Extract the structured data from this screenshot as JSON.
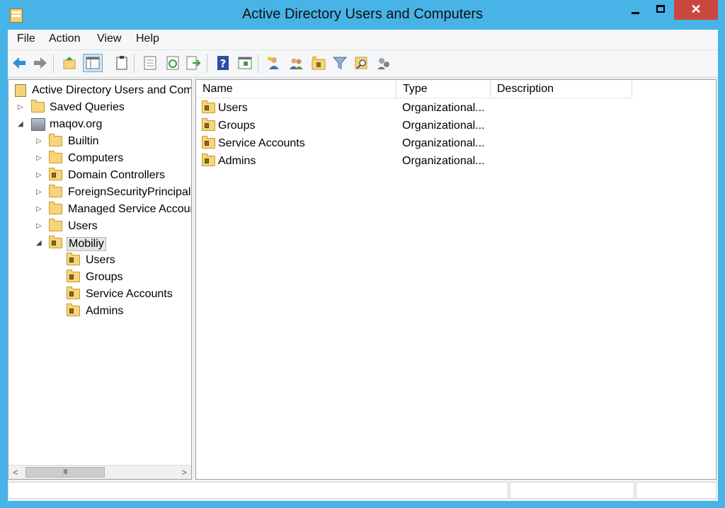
{
  "window": {
    "title": "Active Directory Users and Computers",
    "close_glyph": "✕"
  },
  "menu": {
    "items": [
      "File",
      "Action",
      "View",
      "Help"
    ]
  },
  "toolbar": {
    "icons": [
      "back-arrow-icon",
      "forward-arrow-icon",
      "up-folder-icon",
      "show-hide-console-tree-icon",
      "clipboard-icon",
      "properties-icon",
      "refresh-icon",
      "export-list-icon",
      "help-icon",
      "view-icon",
      "new-user-icon",
      "new-group-icon",
      "new-ou-icon",
      "filter-icon",
      "find-icon",
      "delegate-icon"
    ]
  },
  "tree": {
    "root": "Active Directory Users and Computers [DC...]",
    "items": [
      {
        "label": "Saved Queries",
        "expander": "▷"
      },
      {
        "label": "maqov.org",
        "expander": "◢"
      },
      {
        "label": "Builtin",
        "expander": "▷"
      },
      {
        "label": "Computers",
        "expander": "▷"
      },
      {
        "label": "Domain Controllers",
        "expander": "▷"
      },
      {
        "label": "ForeignSecurityPrincipals",
        "expander": "▷"
      },
      {
        "label": "Managed Service Accounts",
        "expander": "▷"
      },
      {
        "label": "Users",
        "expander": "▷"
      },
      {
        "label": "Mobiliy",
        "expander": "◢",
        "selected": true
      },
      {
        "label": "Users"
      },
      {
        "label": "Groups"
      },
      {
        "label": "Service Accounts"
      },
      {
        "label": "Admins"
      }
    ],
    "scroll_thumb_glyph": "III",
    "scroll_left_glyph": "<",
    "scroll_right_glyph": ">"
  },
  "list": {
    "columns": [
      "Name",
      "Type",
      "Description"
    ],
    "rows": [
      {
        "name": "Users",
        "type": "Organizational...",
        "description": ""
      },
      {
        "name": "Groups",
        "type": "Organizational...",
        "description": ""
      },
      {
        "name": "Service Accounts",
        "type": "Organizational...",
        "description": ""
      },
      {
        "name": "Admins",
        "type": "Organizational...",
        "description": ""
      }
    ]
  },
  "colors": {
    "frame": "#48b3e6",
    "close_button": "#c9473f",
    "folder": "#f6d57b"
  }
}
